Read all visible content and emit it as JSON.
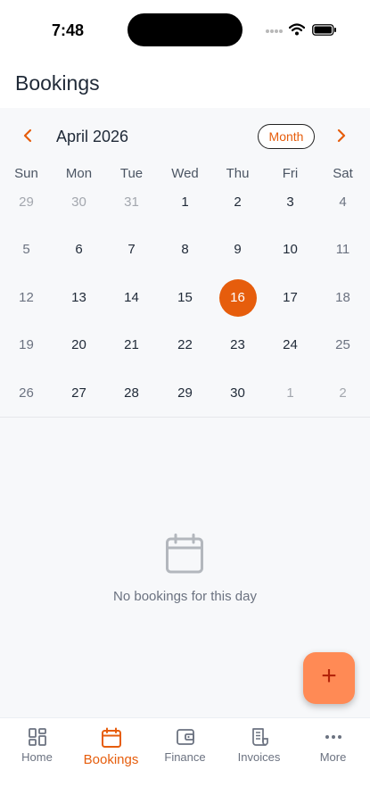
{
  "status_bar": {
    "time": "7:48"
  },
  "header": {
    "title": "Bookings"
  },
  "calendar": {
    "month_label": "April 2026",
    "view_toggle": "Month",
    "weekdays": [
      "Sun",
      "Mon",
      "Tue",
      "Wed",
      "Thu",
      "Fri",
      "Sat"
    ],
    "weeks": [
      [
        "29",
        "30",
        "31",
        "1",
        "2",
        "3",
        "4"
      ],
      [
        "5",
        "6",
        "7",
        "8",
        "9",
        "10",
        "11"
      ],
      [
        "12",
        "13",
        "14",
        "15",
        "16",
        "17",
        "18"
      ],
      [
        "19",
        "20",
        "21",
        "22",
        "23",
        "24",
        "25"
      ],
      [
        "26",
        "27",
        "28",
        "29",
        "30",
        "1",
        "2"
      ]
    ],
    "selected_day": "16"
  },
  "empty_state": {
    "icon": "calendar-icon",
    "message": "No bookings for this day"
  },
  "fab": {
    "label": "+",
    "icon": "plus-icon"
  },
  "tabs": [
    {
      "label": "Home",
      "icon": "grid-icon"
    },
    {
      "label": "Bookings",
      "icon": "calendar-icon"
    },
    {
      "label": "Finance",
      "icon": "wallet-icon"
    },
    {
      "label": "Invoices",
      "icon": "receipt-icon"
    },
    {
      "label": "More",
      "icon": "more-dots-icon"
    }
  ],
  "colors": {
    "accent": "#e65d0c",
    "fab_background": "#ff8a55",
    "content_background": "#f7f8fa"
  }
}
